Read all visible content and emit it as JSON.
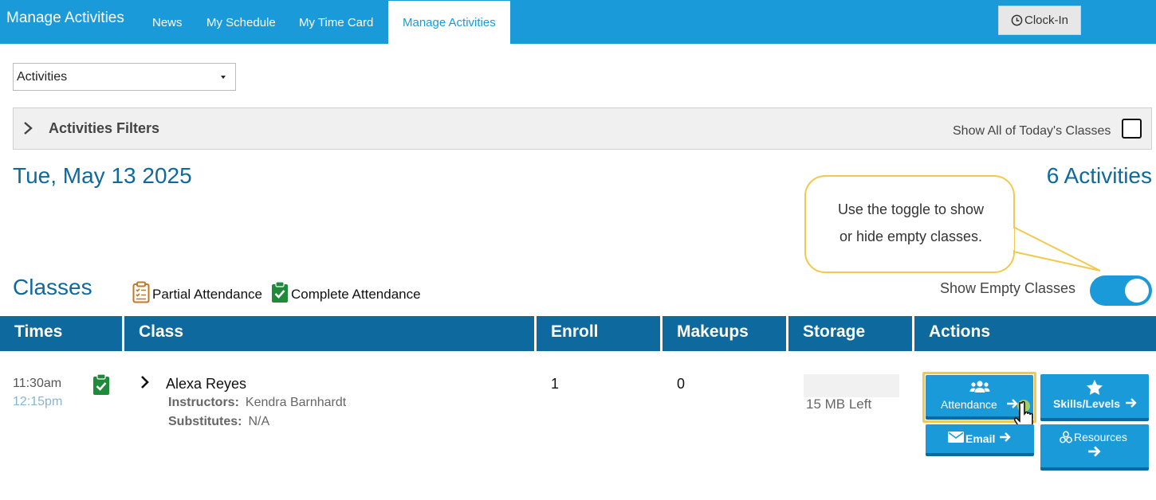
{
  "nav": {
    "brand": "Manage Activities",
    "tabs": [
      {
        "label": "News"
      },
      {
        "label": "My Schedule"
      },
      {
        "label": "My Time Card"
      },
      {
        "label": "Manage Activities",
        "active": true
      }
    ],
    "clockin_label": "Clock-In"
  },
  "view_select": {
    "value": "Activities"
  },
  "filters": {
    "title": "Activities Filters",
    "show_all_label": "Show All of Today's Classes",
    "show_all_checked": false
  },
  "summary": {
    "date": "Tue, May 13 2025",
    "count": "6 Activities"
  },
  "callout": {
    "line1": "Use the toggle to show",
    "line2": "or hide  empty classes."
  },
  "classes_section": {
    "title": "Classes",
    "legend_partial": "Partial Attendance",
    "legend_complete": "Complete Attendance",
    "toggle_label": "Show Empty Classes",
    "toggle_on": true
  },
  "table": {
    "headers": [
      "Times",
      "Class",
      "Enroll",
      "Makeups",
      "Storage",
      "Actions"
    ],
    "rows": [
      {
        "start": "11:30am",
        "end": "12:15pm",
        "name": "Alexa Reyes",
        "instructors_label": "Instructors:",
        "instructors": "Kendra Barnhardt",
        "substitutes_label": "Substitutes:",
        "substitutes": "N/A",
        "enroll": "1",
        "makeups": "0",
        "storage": "15 MB Left",
        "actions": {
          "attendance": "Attendance",
          "skills": "Skills/Levels",
          "email": "Email",
          "resources": "Resources"
        }
      }
    ]
  },
  "colors": {
    "primary": "#1a9ad9",
    "dark_header": "#0e6a9e",
    "complete_green": "#1e8a3a",
    "partial_orange": "#c0782a",
    "highlight": "#f2c94c"
  }
}
